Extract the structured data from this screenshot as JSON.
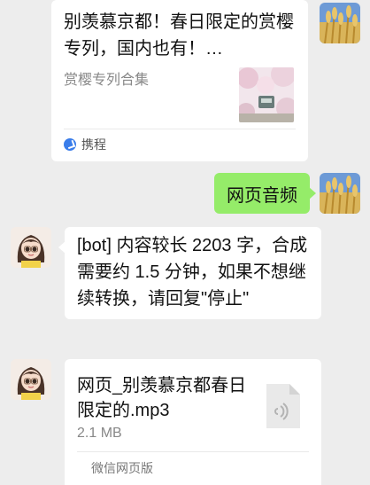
{
  "messages": {
    "article": {
      "title": "别羡慕京都！春日限定的赏樱专列，国内也有！…",
      "subtitle": "赏樱专列合集",
      "source": "携程"
    },
    "outgoing": {
      "text": "网页音频"
    },
    "bot_reply": {
      "text": "[bot] 内容较长 2203 字，合成需要约 1.5 分钟，如果不想继续转换，请回复\"停止\""
    },
    "file": {
      "name": "网页_别羡慕京都春日限定的.mp3",
      "size": "2.1 MB",
      "footer": "微信网页版"
    }
  },
  "colors": {
    "background": "#ededed",
    "outgoing_bubble": "#95ec69",
    "incoming_bubble": "#ffffff",
    "source_icon": "#3a7dea"
  },
  "icons": {
    "source": "ctrip-logo-icon",
    "file": "audio-file-icon"
  }
}
